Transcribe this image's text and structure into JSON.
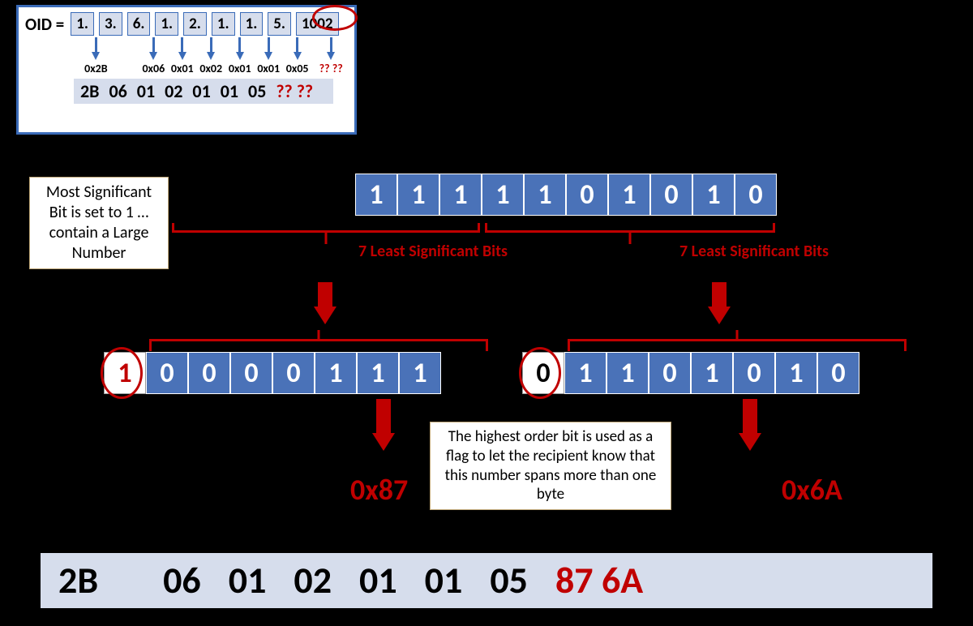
{
  "oid": {
    "label": "OID =",
    "parts": [
      "1.",
      "3.",
      "6.",
      "1.",
      "2.",
      "1.",
      "1.",
      "5.",
      "1002"
    ],
    "hex_labels": [
      "0x2B",
      "0x06",
      "0x01",
      "0x02",
      "0x01",
      "0x01",
      "0x05",
      "?? ??"
    ],
    "bottom_bytes": [
      "2B",
      "06",
      "01",
      "02",
      "01",
      "01",
      "05",
      "?? ??"
    ]
  },
  "binary_1002": [
    "1",
    "1",
    "1",
    "1",
    "1",
    "0",
    "1",
    "0",
    "1",
    "0"
  ],
  "annotations": {
    "msb_note": "Most Significant Bit is set to 1  … contain a Large Number",
    "seven_lsb": "7 Least Significant Bits",
    "flag_note": "The highest order bit is used as a flag to let the recipient know that this number spans more than one byte"
  },
  "byte1": {
    "lead": "1",
    "bits": [
      "0",
      "0",
      "0",
      "0",
      "1",
      "1",
      "1"
    ],
    "hex": "0x87"
  },
  "byte2": {
    "lead": "0",
    "bits": [
      "1",
      "1",
      "0",
      "1",
      "0",
      "1",
      "0"
    ],
    "hex": "0x6A"
  },
  "final": [
    "2B",
    "06",
    "01",
    "02",
    "01",
    "01",
    "05",
    "87 6A"
  ]
}
